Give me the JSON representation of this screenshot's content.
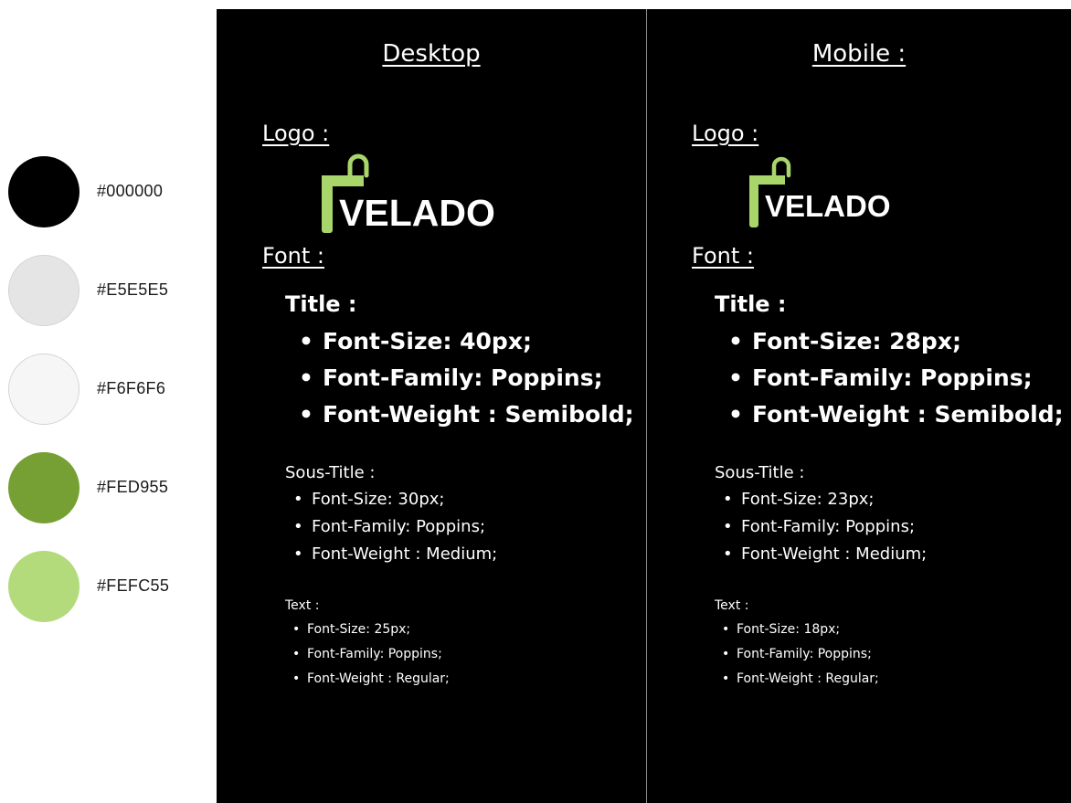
{
  "palette": [
    {
      "hex": "#000000",
      "fill": "#000000",
      "bordered": false
    },
    {
      "hex": "#E5E5E5",
      "fill": "#E5E5E5",
      "bordered": true
    },
    {
      "hex": "#F6F6F6",
      "fill": "#F6F6F6",
      "bordered": true
    },
    {
      "hex": "#FED955",
      "fill": "#76A034",
      "bordered": false
    },
    {
      "hex": "#FEFC55",
      "fill": "#B3DB7B",
      "bordered": false
    }
  ],
  "colors": {
    "panel_bg": "#000000",
    "logo_green": "#A8D66A",
    "text": "#FFFFFF"
  },
  "logo_text": "VELADO",
  "desktop": {
    "heading": "Desktop",
    "logo_label": "Logo :",
    "font_label": "Font :",
    "title": {
      "label": "Title  :",
      "items": [
        "Font-Size: 40px;",
        "Font-Family: Poppins;",
        "Font-Weight : Semibold;"
      ]
    },
    "sous_title": {
      "label": "Sous-Title  :",
      "items": [
        "Font-Size: 30px;",
        "Font-Family: Poppins;",
        "Font-Weight : Medium;"
      ]
    },
    "text": {
      "label": "Text  :",
      "items": [
        "Font-Size: 25px;",
        "Font-Family: Poppins;",
        "Font-Weight : Regular;"
      ]
    }
  },
  "mobile": {
    "heading": "Mobile :",
    "logo_label": "Logo :",
    "font_label": "Font :",
    "title": {
      "label": "Title  :",
      "items": [
        "Font-Size: 28px;",
        "Font-Family: Poppins;",
        "Font-Weight : Semibold;"
      ]
    },
    "sous_title": {
      "label": "Sous-Title  :",
      "items": [
        "Font-Size: 23px;",
        "Font-Family: Poppins;",
        "Font-Weight : Medium;"
      ]
    },
    "text": {
      "label": "Text  :",
      "items": [
        "Font-Size: 18px;",
        "Font-Family: Poppins;",
        "Font-Weight : Regular;"
      ]
    }
  }
}
